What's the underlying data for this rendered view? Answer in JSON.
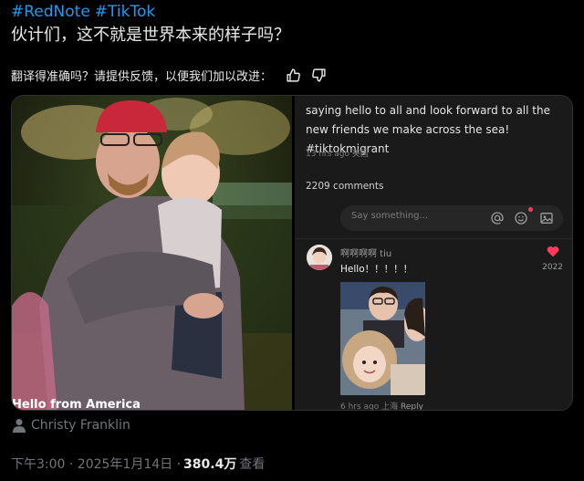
{
  "post": {
    "hashtags": [
      "#RedNote",
      "#TikTok"
    ],
    "text": "伙计们，这不就是世界本来的样子吗？"
  },
  "feedback": {
    "question": "翻译得准确吗？请提供反馈，以便我们加以改进：",
    "thumbs_up_icon": "thumbs-up-icon",
    "thumbs_down_icon": "thumbs-down-icon"
  },
  "media": {
    "photo_caption": "Hello from America",
    "app": {
      "caption": "saying hello to all and look forward to all the new friends we make across the sea! #tiktokmigrant",
      "caption_meta": "13 hrs ago 美国",
      "comments_count": "2209 comments",
      "comment_placeholder": "Say something...",
      "comment": {
        "username": "啊啊啊啊 tiu",
        "text": "Hello！！！！！",
        "likes": "2022",
        "time": "6 hrs ago 上海",
        "reply_label": "Reply"
      }
    }
  },
  "author": {
    "name": "Christy Franklin"
  },
  "footer": {
    "time": "下午3:00 · 2025年1月14日 ·",
    "views_count": "380.4万",
    "views_label": "查看"
  },
  "colors": {
    "link": "#1d9bf0",
    "heart": "#ff3b5c",
    "muted": "#71767b"
  }
}
